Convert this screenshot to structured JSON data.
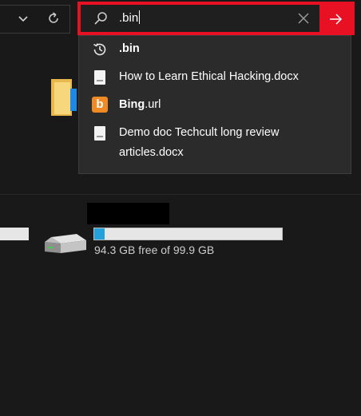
{
  "search": {
    "query": ".bin"
  },
  "suggestions": [
    {
      "type": "history",
      "icon": "history-icon",
      "label": ".bin",
      "bold": true
    },
    {
      "type": "file",
      "icon": "docx-file-icon",
      "label": "How to Learn Ethical Hacking.docx"
    },
    {
      "type": "web",
      "icon": "bing-icon",
      "label": "Bing.url",
      "bold_part": "Bing",
      "rest_part": ".url"
    },
    {
      "type": "file",
      "icon": "docx-file-icon",
      "label_line1": "Demo doc Techcult long review",
      "label_line2": "articles.docx"
    }
  ],
  "drive": {
    "free_text": "94.3 GB free of 99.9 GB",
    "used_fraction": 0.056
  },
  "colors": {
    "accent_red": "#e81123",
    "progress_blue": "#26a0da",
    "bing_orange": "#f08a24"
  }
}
